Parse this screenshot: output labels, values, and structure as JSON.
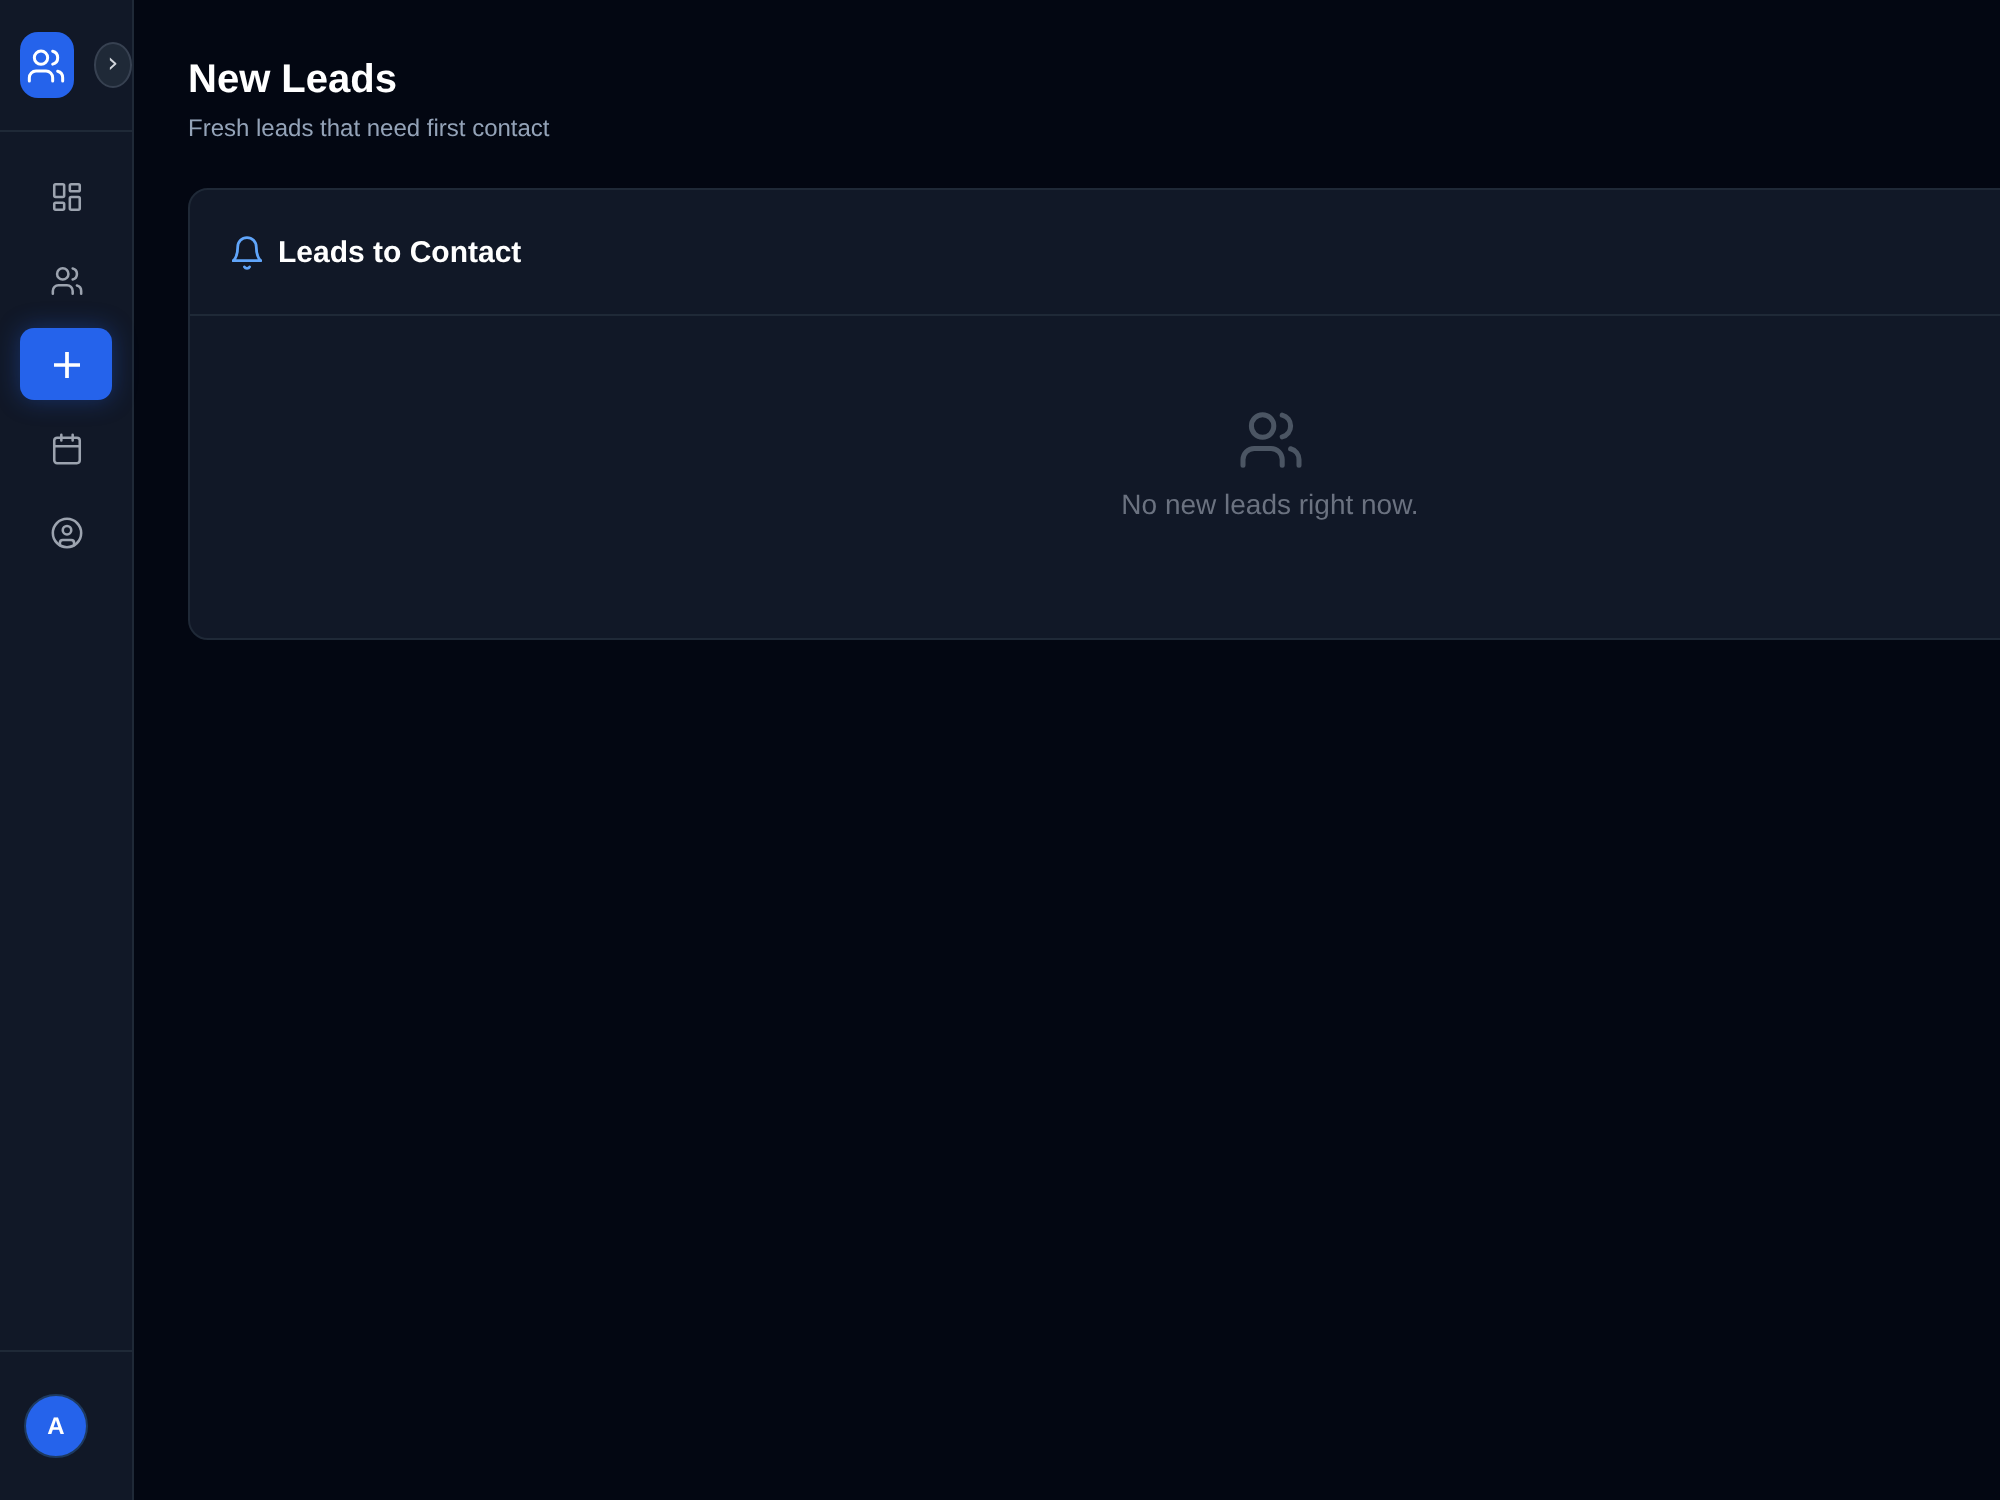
{
  "sidebar": {
    "expand_button": {
      "glyph": "›"
    },
    "nav_items": [
      {
        "kind": "dashboard",
        "selected": false
      },
      {
        "kind": "contacts",
        "selected": false
      },
      {
        "kind": "add",
        "selected": true
      },
      {
        "kind": "calendar",
        "selected": false
      },
      {
        "kind": "profile",
        "selected": false
      }
    ],
    "avatar": {
      "initial": "A"
    }
  },
  "header": {
    "title": "New Leads",
    "subtitle": "Fresh leads that need first contact"
  },
  "card": {
    "title": "Leads to Contact",
    "empty_message": "No new leads right now."
  }
}
